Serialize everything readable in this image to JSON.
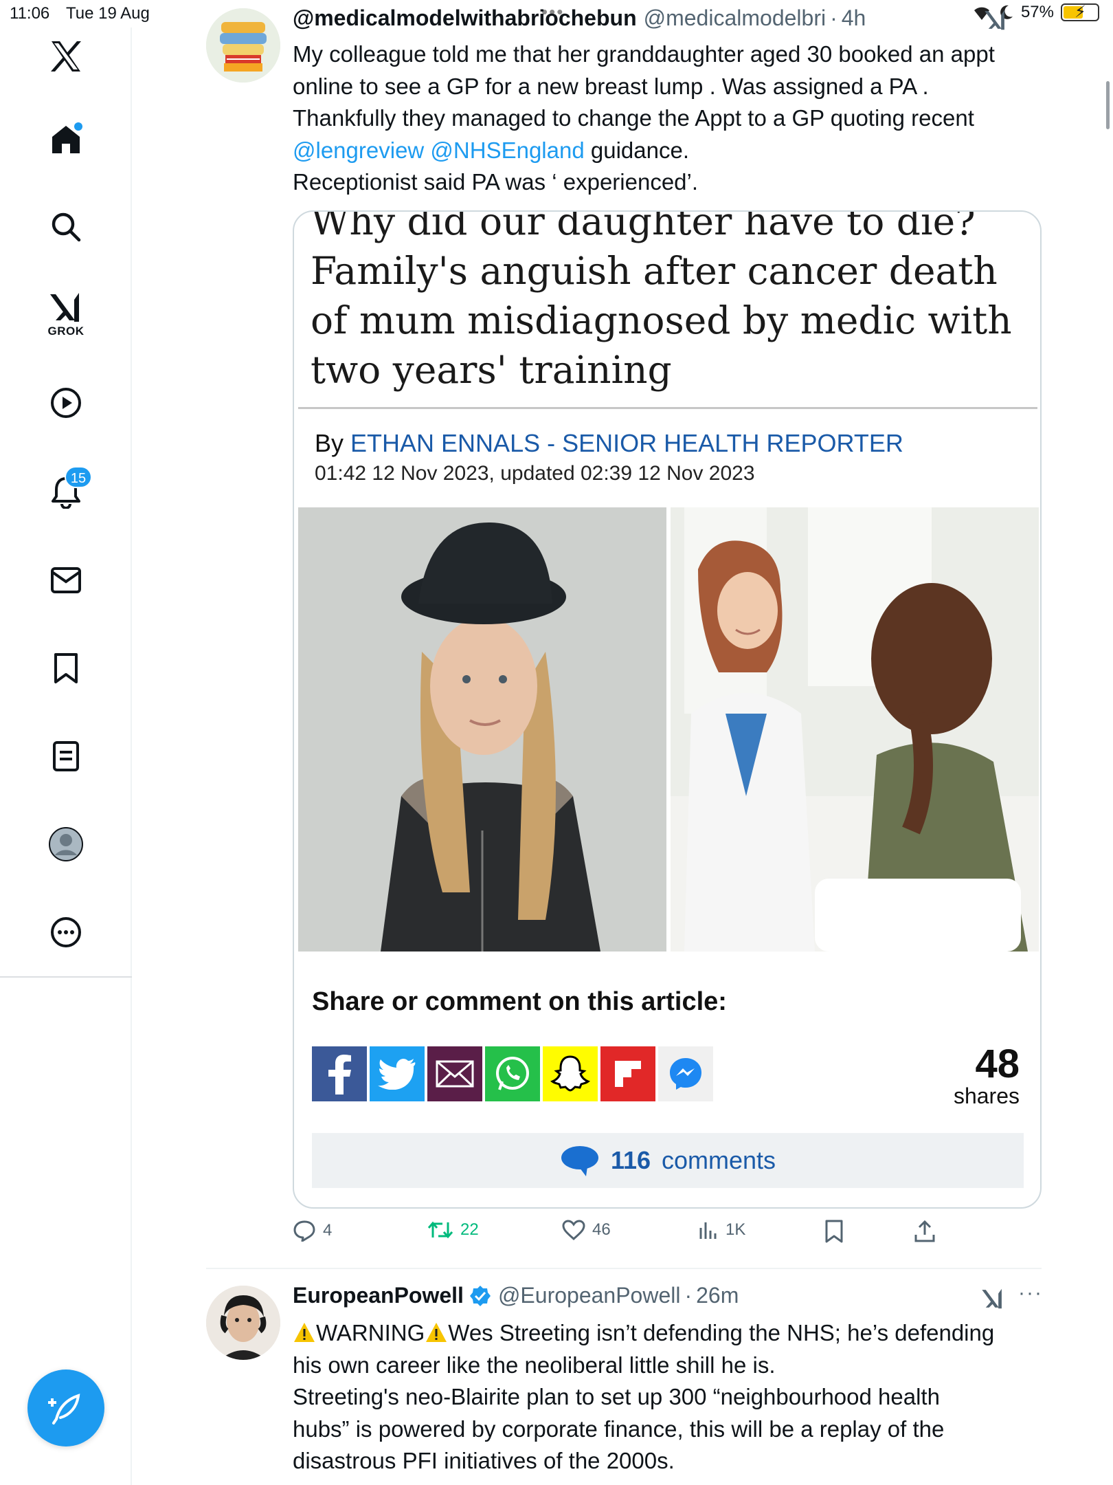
{
  "status_bar": {
    "time": "11:06",
    "date": "Tue 19 Aug",
    "battery": "57%"
  },
  "sidebar": {
    "items": [
      {
        "name": "x-logo"
      },
      {
        "name": "home"
      },
      {
        "name": "search"
      },
      {
        "name": "grok",
        "label": "GROK"
      },
      {
        "name": "video"
      },
      {
        "name": "notifications",
        "badge": "15"
      },
      {
        "name": "messages"
      },
      {
        "name": "bookmarks"
      },
      {
        "name": "lists"
      },
      {
        "name": "profile"
      },
      {
        "name": "more"
      }
    ]
  },
  "tweets": [
    {
      "name": "@medicalmodelwithabriochebun",
      "handle": "@medicalmodelbri",
      "time": "4h",
      "text": {
        "line1": "My colleague told me that her granddaughter aged 30 booked an appt",
        "line2": "online to see a GP for a new breast lump . Was assigned a PA .",
        "line3": "Thankfully they managed to change the Appt to a GP quoting recent",
        "mention1": "@lengreview",
        "mention2": "@NHSEngland",
        "line4_rest": "guidance.",
        "line5": "Receptionist said PA was ‘ experienced’."
      },
      "article": {
        "title": "Why did our daughter have to die? Family's anguish after cancer death of mum misdiagnosed by medic with two years' training",
        "by": "By",
        "author": "ETHAN ENNALS - SENIOR HEALTH REPORTER",
        "datetime": "01:42 12 Nov 2023, updated 02:39 12 Nov 2023",
        "share_title": "Share or comment on this article:",
        "shares_count": "48",
        "shares_label": "shares",
        "comments_count": "116",
        "comments_label": "comments"
      },
      "actions": {
        "replies": "4",
        "reposts": "22",
        "likes": "46",
        "views": "1K"
      }
    },
    {
      "name": "EuropeanPowell",
      "handle": "@EuropeanPowell",
      "time": "26m",
      "text": {
        "warning": "WARNING",
        "line1_rest": "Wes Streeting isn’t defending the NHS; he’s defending",
        "line2": "his own career like the neoliberal little shill he is.",
        "line3": "Streeting's neo-Blairite plan to set up 300 “neighbourhood health",
        "line4": "hubs” is powered by corporate finance, this will be a replay of the",
        "line5": "disastrous PFI initiatives of the 2000s."
      }
    }
  ],
  "colors": {
    "accent": "#1d9bf0",
    "repost": "#00ba7c",
    "muted": "#536471",
    "article_link": "#1a5aa8"
  }
}
